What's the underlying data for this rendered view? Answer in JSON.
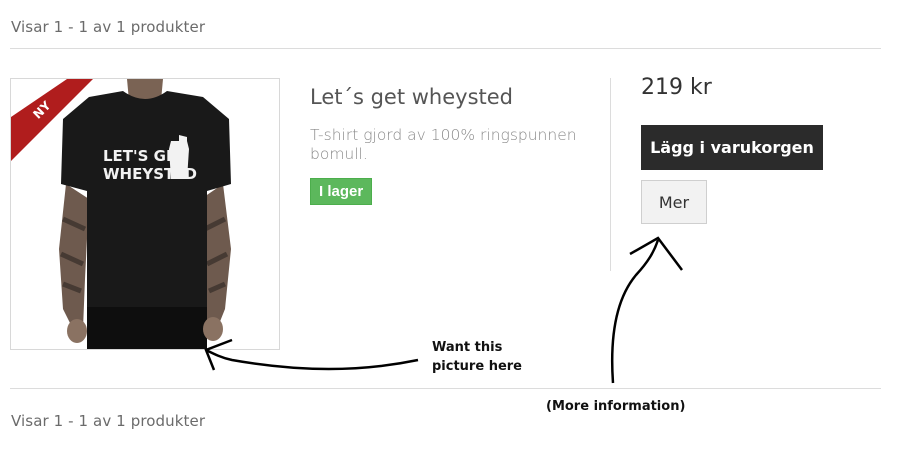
{
  "listing": {
    "count_top": "Visar 1 - 1 av 1 produkter",
    "count_bottom": "Visar 1 - 1 av 1 produkter"
  },
  "product": {
    "badge": "NY",
    "image_text": "LET'S GET WHEYSTED",
    "title": "Let´s get wheysted",
    "description": "T-shirt gjord av 100% ringspunnen bomull.",
    "stock_label": "I lager",
    "price": "219 kr",
    "add_to_cart_label": "Lägg i varukorgen",
    "more_label": "Mer"
  },
  "annotations": {
    "picture_note": "Want this picture here",
    "info_note": "(More information)"
  },
  "colors": {
    "badge": "#b01d1d",
    "stock": "#5cb85c",
    "cart_button": "#2b2b2b"
  }
}
